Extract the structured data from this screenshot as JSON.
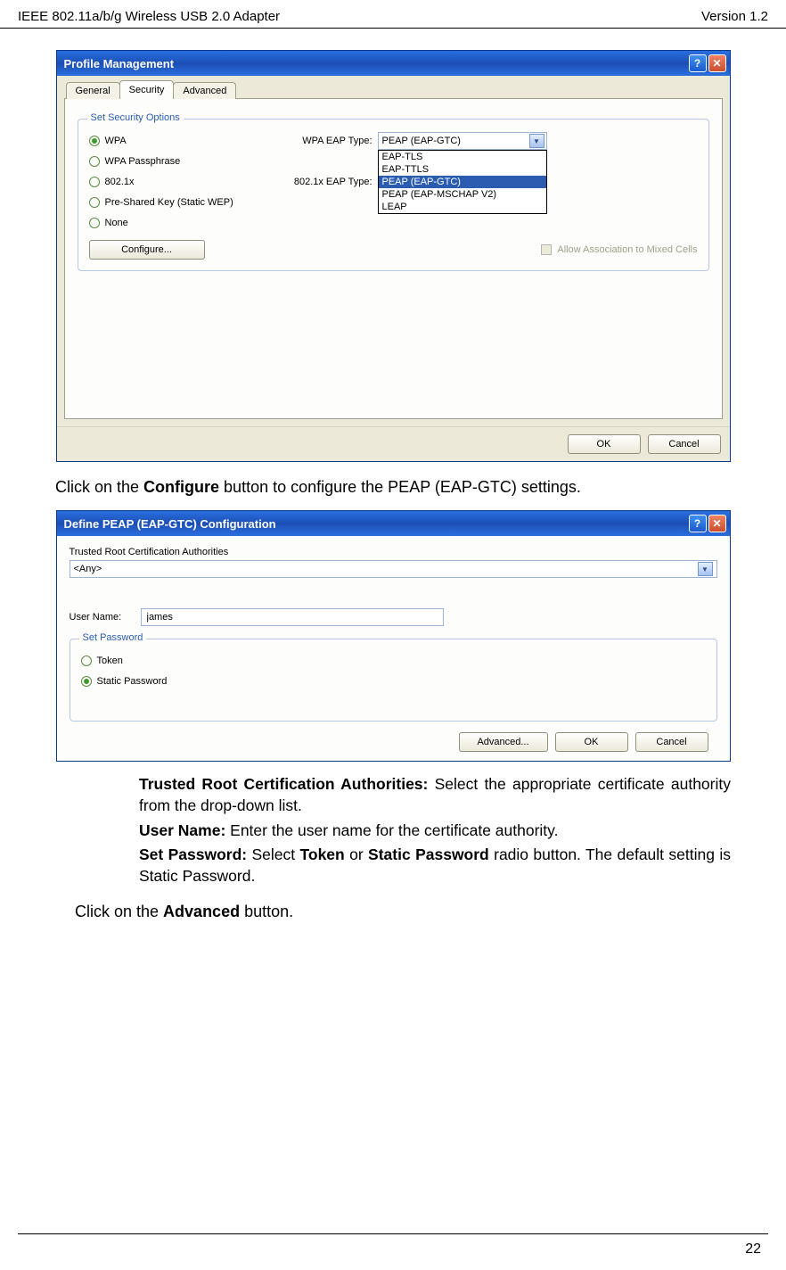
{
  "header": {
    "left": "IEEE 802.11a/b/g Wireless USB 2.0 Adapter",
    "right": "Version 1.2"
  },
  "dialog1": {
    "title": "Profile Management",
    "tabs": [
      "General",
      "Security",
      "Advanced"
    ],
    "group_legend": "Set Security Options",
    "radios": [
      "WPA",
      "WPA Passphrase",
      "802.1x",
      "Pre-Shared Key (Static WEP)",
      "None"
    ],
    "wpa_label": "WPA EAP Type:",
    "dot1x_label": "802.1x EAP Type:",
    "wpa_value": "PEAP (EAP-GTC)",
    "eap_options": [
      "EAP-TLS",
      "EAP-TTLS",
      "PEAP (EAP-GTC)",
      "PEAP (EAP-MSCHAP V2)",
      "LEAP"
    ],
    "configure_btn": "Configure...",
    "mixed_cells": "Allow Association to Mixed Cells",
    "ok": "OK",
    "cancel": "Cancel"
  },
  "para1_a": "Click on the ",
  "para1_b": "Configure",
  "para1_c": " button to configure the PEAP (EAP-GTC) settings.",
  "dialog2": {
    "title": "Define PEAP (EAP-GTC) Configuration",
    "trca_label": "Trusted Root Certification Authorities",
    "trca_value": "<Any>",
    "user_label": "User Name:",
    "user_value": "james",
    "pw_legend": "Set Password",
    "pw_options": [
      "Token",
      "Static Password"
    ],
    "advanced": "Advanced...",
    "ok": "OK",
    "cancel": "Cancel"
  },
  "bullets": {
    "b1a": "Trusted Root Certification Authorities:",
    "b1b": " Select the appropriate certificate authority from the drop-down list.",
    "b2a": "User Name:",
    "b2b": " Enter the user name for the certificate authority.",
    "b3a": "Set Password:",
    "b3b": " Select ",
    "b3c": "Token",
    "b3d": " or ",
    "b3e": "Static Password",
    "b3f": " radio button. The default setting is Static Password."
  },
  "para2_a": "Click on the ",
  "para2_b": "Advanced",
  "para2_c": " button.",
  "page_num": "22"
}
